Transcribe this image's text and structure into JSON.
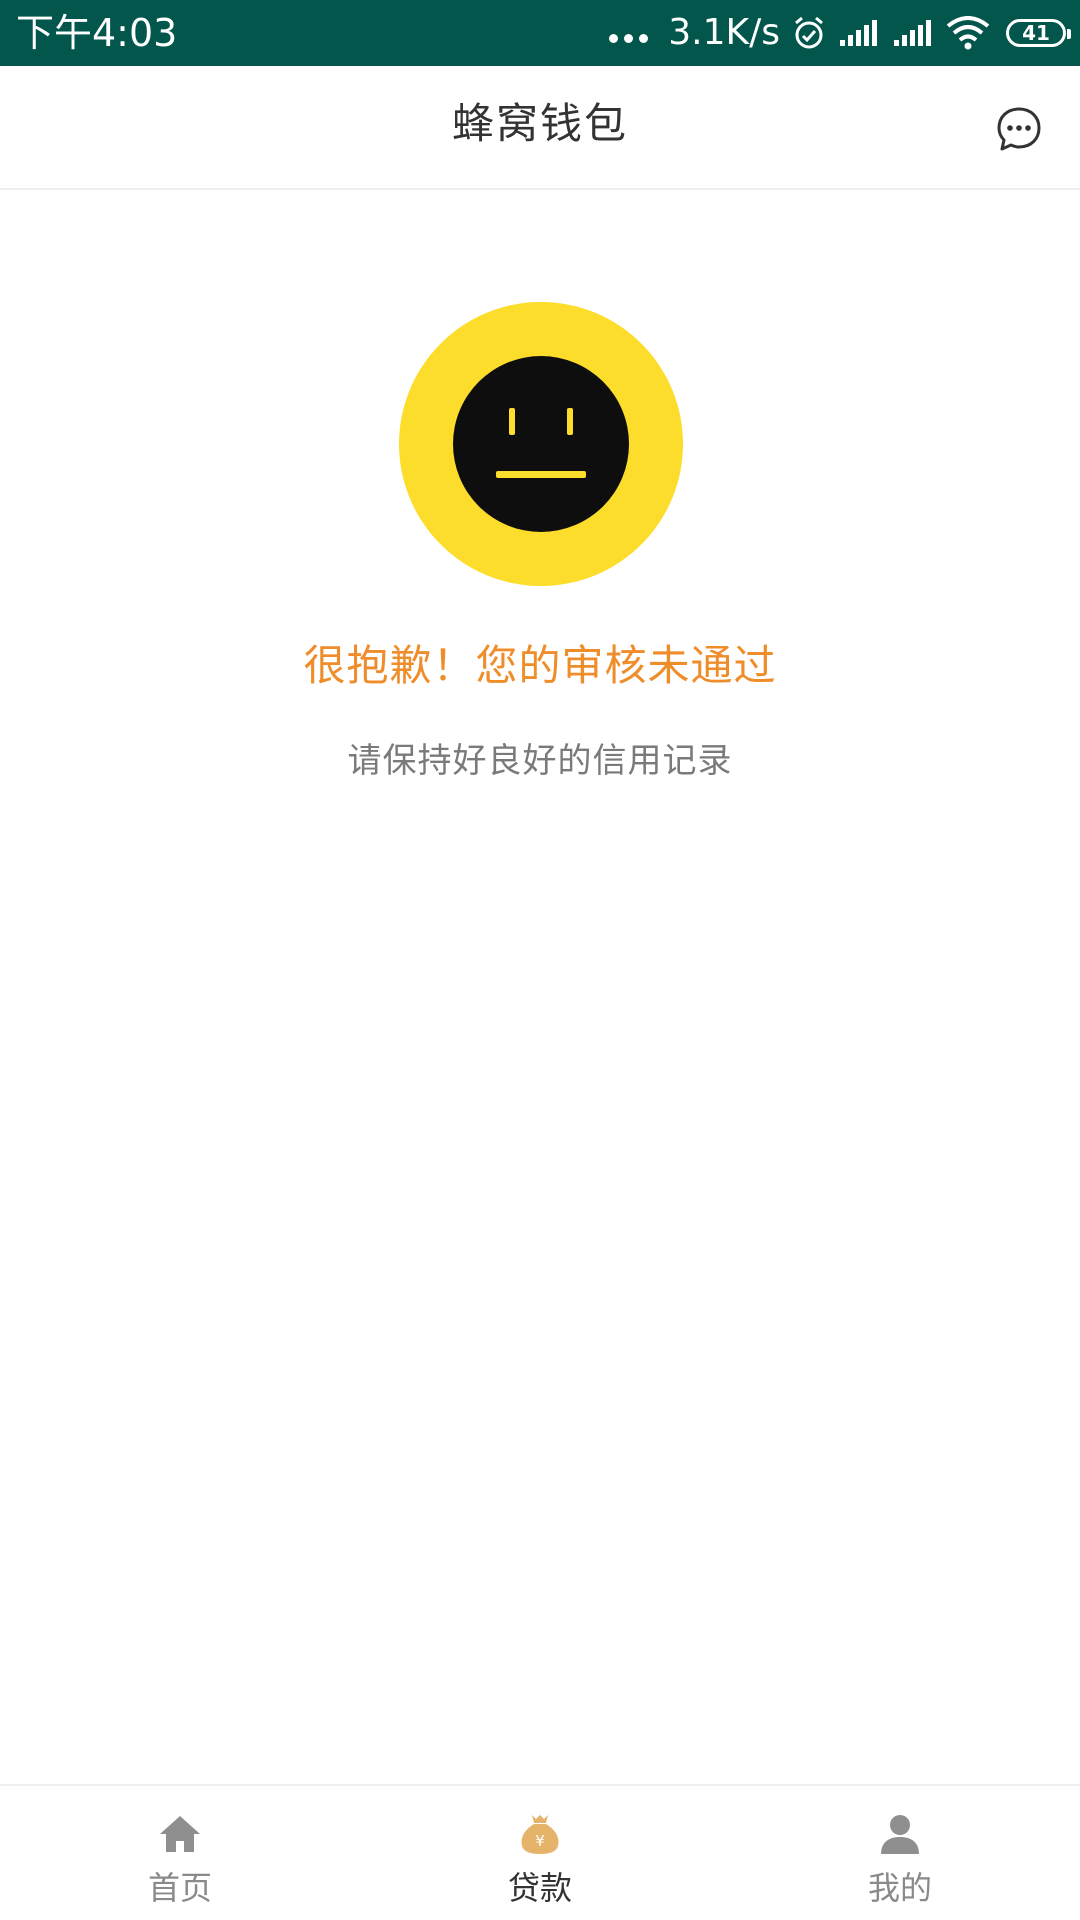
{
  "status_bar": {
    "time": "下午4:03",
    "net_speed": "3.1K/s",
    "battery": "41",
    "bg_color": "#02564b",
    "icons": [
      "more-dots-icon",
      "alarm-icon",
      "signal-icon",
      "signal-icon",
      "wifi-icon",
      "battery-icon"
    ]
  },
  "header": {
    "title": "蜂窝钱包",
    "message_icon": "chat-bubble-icon"
  },
  "result": {
    "icon": "neutral-face-icon",
    "title": "很抱歉！您的审核未通过",
    "subtitle": "请保持好良好的信用记录",
    "title_color": "#ef8d2a",
    "icon_bg_color": "#fddd2c"
  },
  "bottom_nav": {
    "items": [
      {
        "label": "首页",
        "icon": "home-icon",
        "active": false
      },
      {
        "label": "贷款",
        "icon": "money-bag-icon",
        "active": true
      },
      {
        "label": "我的",
        "icon": "user-icon",
        "active": false
      }
    ],
    "active_icon_color": "#e6b36a",
    "inactive_icon_color": "#8f8f8f"
  }
}
